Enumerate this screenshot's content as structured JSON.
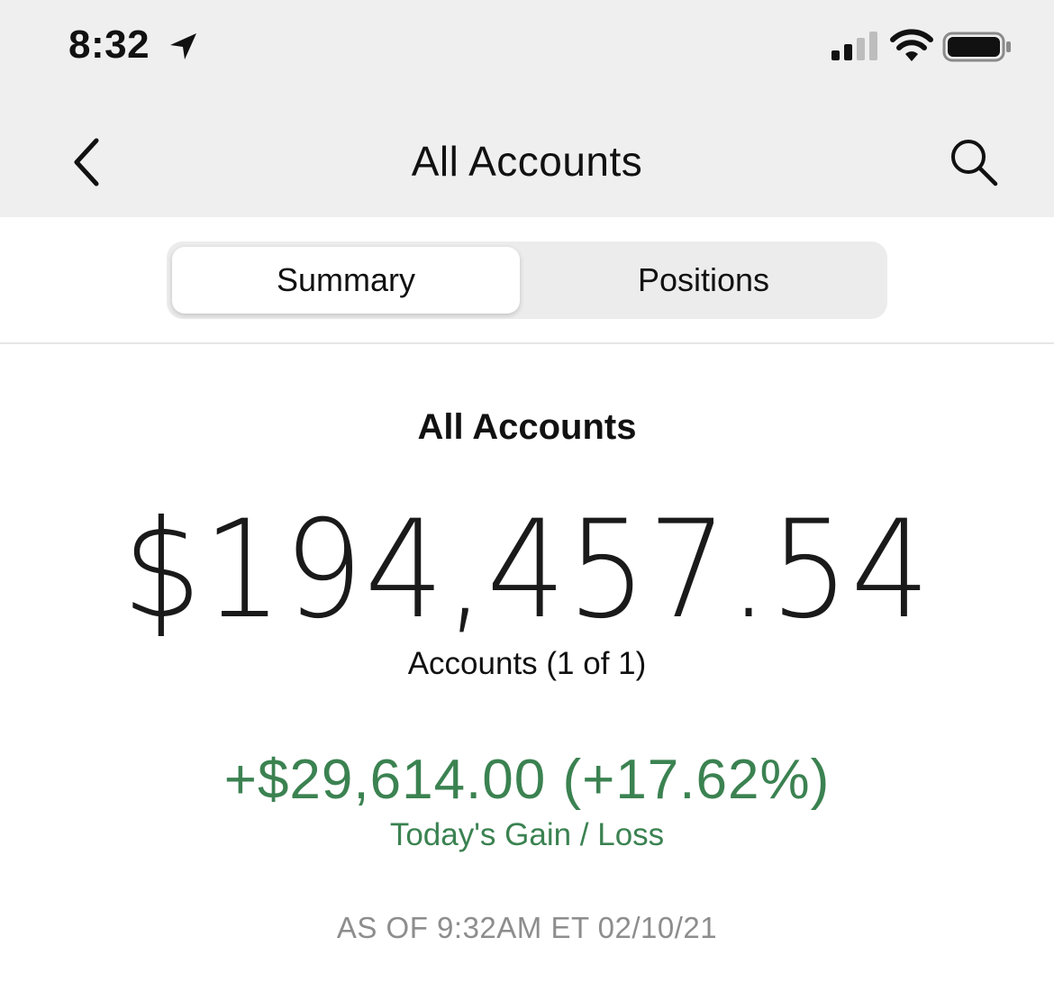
{
  "status_bar": {
    "time": "8:32",
    "icons": [
      "location-arrow-icon",
      "cellular-signal-icon",
      "wifi-icon",
      "battery-icon"
    ]
  },
  "nav_bar": {
    "title": "All Accounts",
    "left_icon": "chevron-left-icon",
    "right_icon": "search-icon"
  },
  "segmented_control": {
    "segments": [
      {
        "label": "Summary",
        "selected": true
      },
      {
        "label": "Positions",
        "selected": false
      }
    ]
  },
  "summary": {
    "title": "All Accounts",
    "balance": "$194,457.54",
    "accounts_label": "Accounts (1 of 1)",
    "gain_value": "+$29,614.00 (+17.62%)",
    "gain_label": "Today's Gain / Loss",
    "as_of": "AS OF 9:32AM ET 02/10/21"
  },
  "colors": {
    "header_background": "#efefef",
    "gain_green": "#3b8251",
    "timestamp_gray": "#8d8d8d",
    "text_primary": "#111111"
  }
}
